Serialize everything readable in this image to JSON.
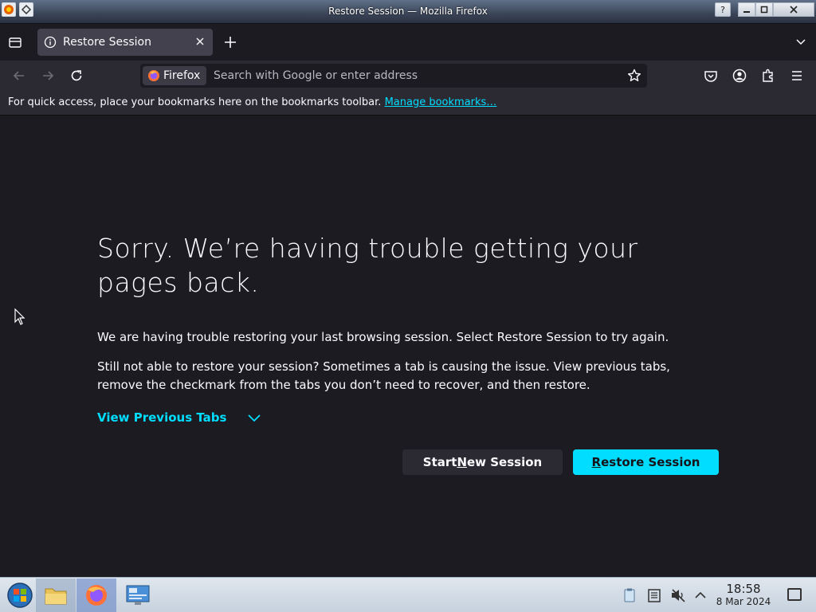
{
  "window": {
    "title": "Restore Session — Mozilla Firefox"
  },
  "tab": {
    "label": "Restore Session"
  },
  "urlbar": {
    "identity_label": "Firefox",
    "placeholder": "Search with Google or enter address"
  },
  "bookmarks_toolbar": {
    "text": "For quick access, place your bookmarks here on the bookmarks toolbar.",
    "link": "Manage bookmarks…"
  },
  "page": {
    "title": "Sorry. We’re having trouble getting your pages back.",
    "paragraph1": "We are having trouble restoring your last browsing session. Select Restore Session to try again.",
    "paragraph2": "Still not able to restore your session? Sometimes a tab is causing the issue. View previous tabs, remove the checkmark from the tabs you don’t need to recover, and then restore.",
    "view_previous_tabs": "View Previous Tabs",
    "start_new_session": {
      "before": "Start ",
      "accesskey": "N",
      "after": "ew Session"
    },
    "restore_session": {
      "accesskey": "R",
      "after": "estore Session"
    }
  },
  "taskbar": {
    "time": "18:58",
    "date": "8 Mar 2024"
  },
  "colors": {
    "accent": "#00ddff",
    "background": "#1c1b22",
    "toolbar": "#2b2a33",
    "tab": "#42414d"
  }
}
